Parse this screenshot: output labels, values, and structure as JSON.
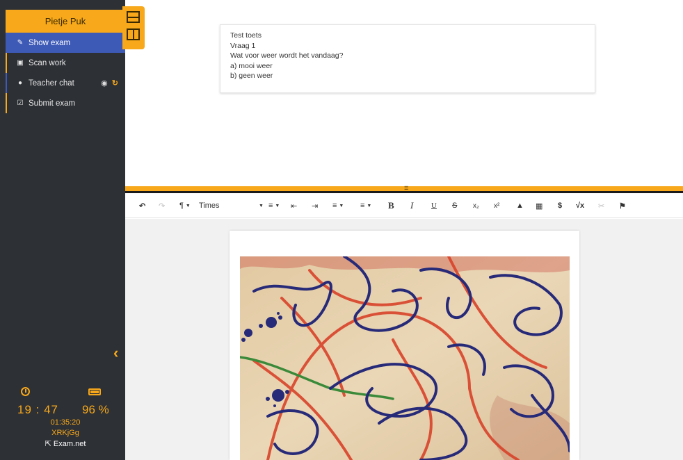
{
  "sidebar": {
    "student_name": "Pietje Puk",
    "nav": [
      {
        "label": "Show exam",
        "icon": "edit-icon"
      },
      {
        "label": "Scan work",
        "icon": "camera-icon"
      },
      {
        "label": "Teacher chat",
        "icon": "chat-icon"
      },
      {
        "label": "Submit exam",
        "icon": "check-square-icon"
      }
    ],
    "status": {
      "time": "19 : 47",
      "battery": "96 %",
      "elapsed": "01:35:20",
      "exam_code": "XRKjGg",
      "brand": "Exam.net"
    }
  },
  "exam": {
    "lines": [
      "Test toets",
      "Vraag 1",
      "Wat voor weer wordt het vandaag?",
      "a) mooi weer",
      "b) geen weer"
    ]
  },
  "toolbar": {
    "font_name": "Times",
    "bold": "B",
    "italic": "I",
    "underline": "U",
    "strike": "S",
    "subscript": "x₂",
    "superscript": "x²",
    "dollar": "$",
    "sqrt": "√x"
  },
  "colors": {
    "accent": "#f7a81b",
    "sidebar": "#2d3035",
    "active": "#3e5ab7"
  }
}
